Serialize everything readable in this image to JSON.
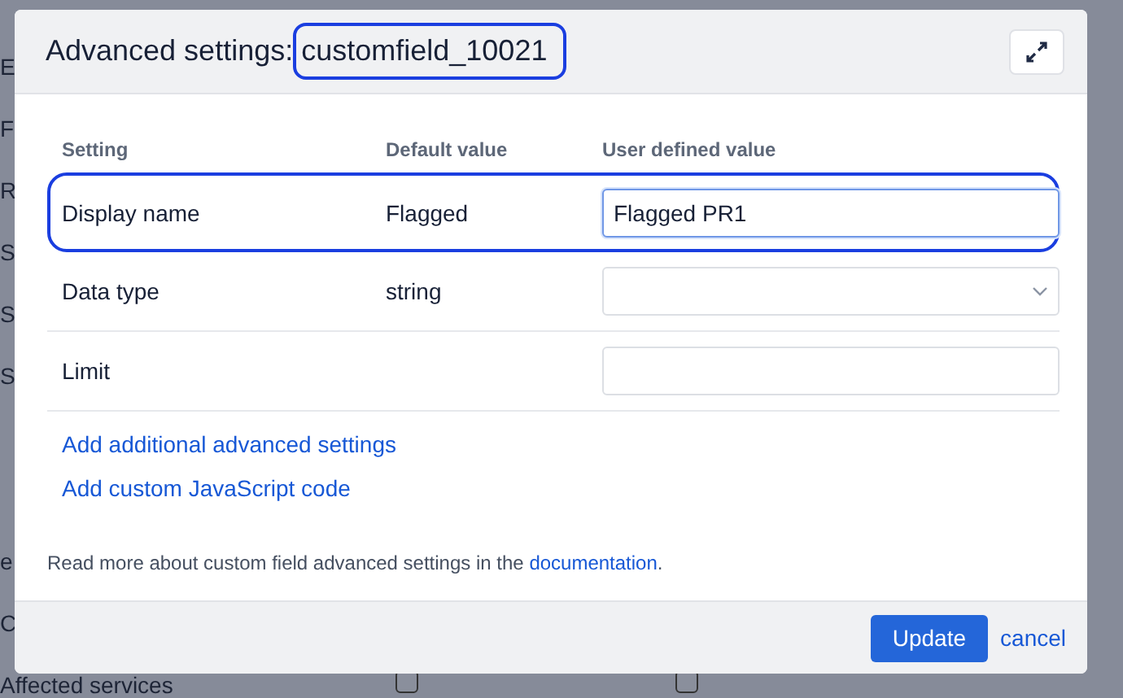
{
  "background": {
    "lines": [
      "E",
      "F",
      "R",
      "S",
      "S",
      "S",
      "e",
      "C",
      "Affected services"
    ],
    "checkboxes": [
      {
        "checked": false
      },
      {
        "checked": false
      }
    ]
  },
  "dialog": {
    "title": "Advanced settings:",
    "field_name": "customfield_10021",
    "field_name_highlighted": true,
    "columns": [
      "Setting",
      "Default value",
      "User defined value"
    ],
    "rows": [
      {
        "setting": "Display name",
        "default": "Flagged",
        "kind": "text",
        "value": "Flagged PR1",
        "focused": true,
        "highlighted": true
      },
      {
        "setting": "Data type",
        "default": "string",
        "kind": "select",
        "value": "",
        "focused": false,
        "highlighted": false
      },
      {
        "setting": "Limit",
        "default": "",
        "kind": "text",
        "value": "",
        "focused": false,
        "highlighted": false
      }
    ],
    "links": [
      "Add additional advanced settings",
      "Add custom JavaScript code"
    ],
    "note": {
      "text": "Read more about custom field advanced settings in the ",
      "link": "documentation",
      "after": "."
    },
    "buttons": {
      "primary": "Update",
      "secondary": "cancel"
    }
  }
}
